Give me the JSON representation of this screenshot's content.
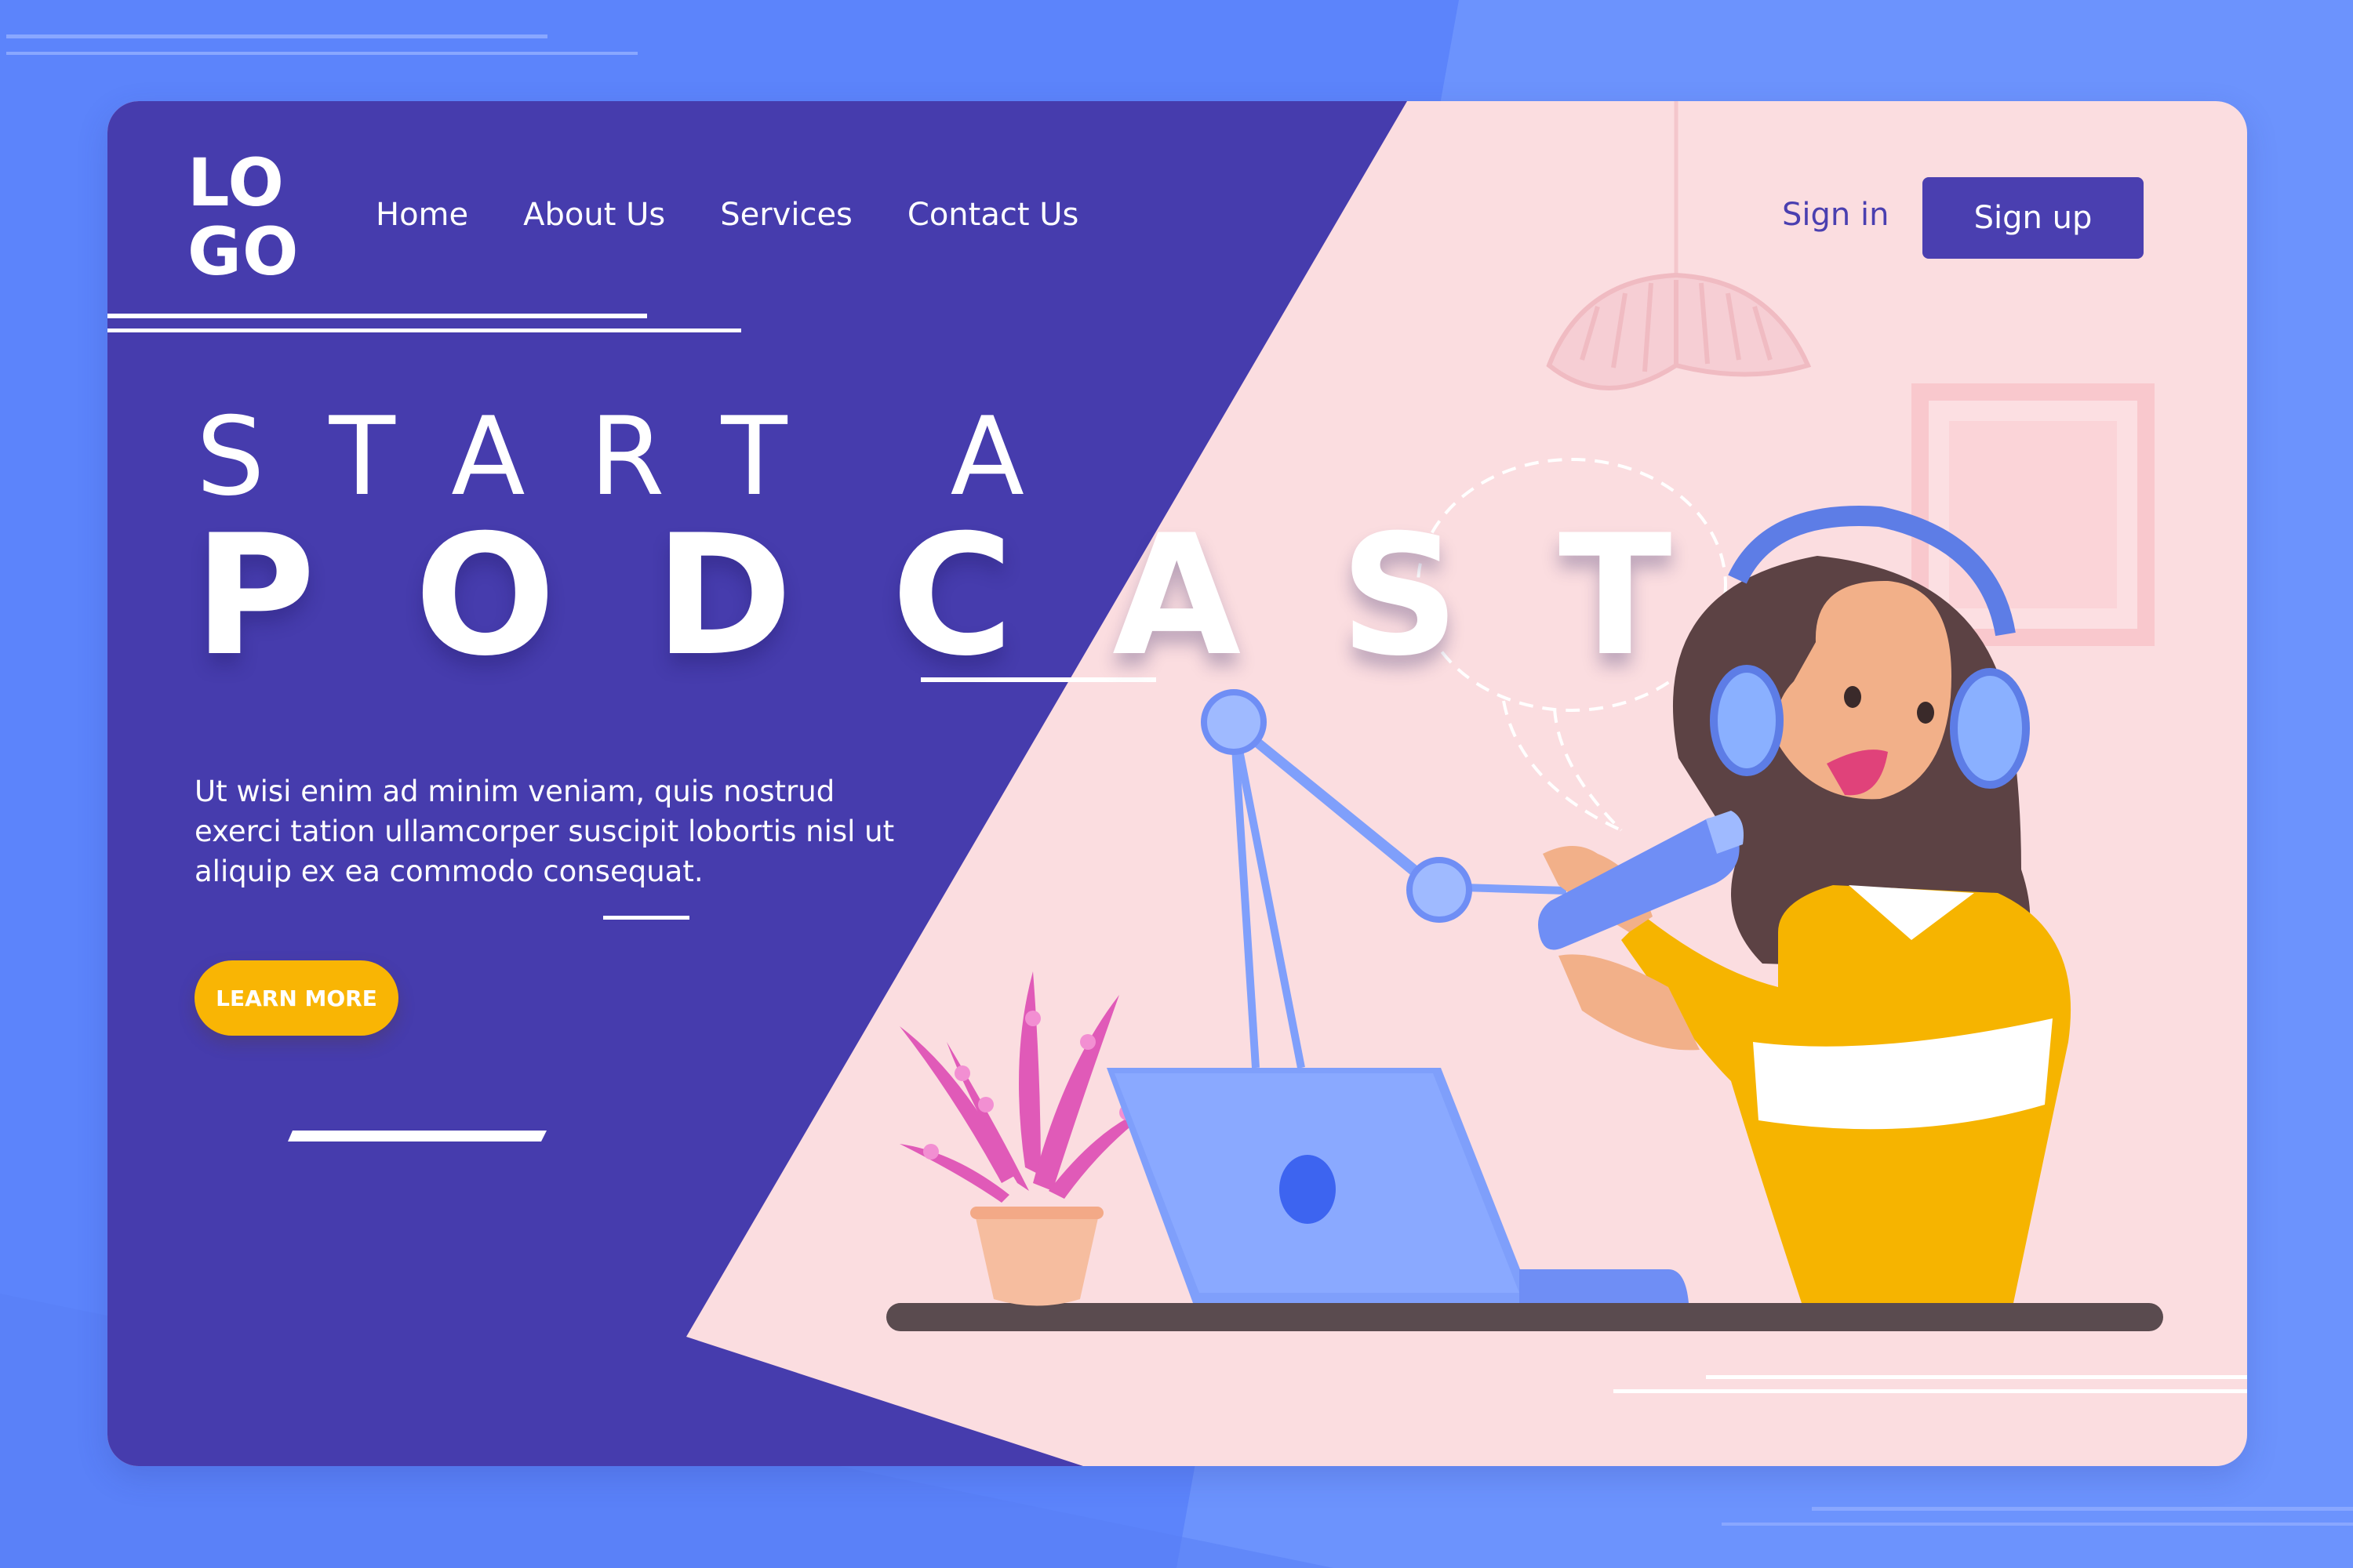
{
  "logo": {
    "line1": "LO",
    "line2": "GO"
  },
  "nav": {
    "home": "Home",
    "about": "About Us",
    "services": "Services",
    "contact": "Contact Us"
  },
  "auth": {
    "signin": "Sign in",
    "signup": "Sign up"
  },
  "hero": {
    "subtitle": "START A",
    "title": "PODCAST",
    "description": "Ut wisi enim ad minim veniam, quis nostrud exerci tation ullamcorper suscipit lobortis nisl ut aliquip ex ea commodo consequat.",
    "cta": "LEARN MORE"
  },
  "colors": {
    "page_bg": "#5c84fb",
    "panel_purple": "#463cad",
    "panel_pink": "#fbdde0",
    "accent_yellow": "#f9b504",
    "signup_bg": "#4a3fb0"
  },
  "illustration": {
    "items": [
      "pendant-lamp-icon",
      "picture-frame-icon",
      "mic-arm-icon",
      "microphone-icon",
      "laptop-icon",
      "potted-plant-icon",
      "podcaster-woman",
      "headphones-icon",
      "speech-bubble-icon"
    ]
  }
}
